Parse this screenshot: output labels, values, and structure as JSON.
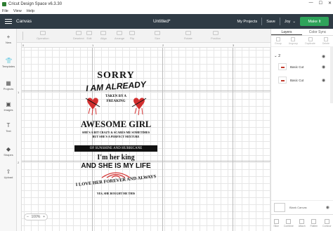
{
  "os": {
    "title": "Cricut Design Space  v6.3.30",
    "menu": [
      "File",
      "View",
      "Help"
    ],
    "win_controls": [
      "—",
      "☐",
      "✕"
    ]
  },
  "header": {
    "section": "Canvas",
    "doc_title": "Untitled*",
    "my_projects": "My Projects",
    "save": "Save",
    "machine": "Joy",
    "make_it": "Make It"
  },
  "toolbar": {
    "items": [
      "Operation",
      "Deselect",
      "Edit",
      "Align",
      "Arrange",
      "Flip",
      "Size",
      "Rotate",
      "Position"
    ]
  },
  "sidebar": {
    "items": [
      {
        "label": "New",
        "icon": "+"
      },
      {
        "label": "Templates",
        "icon": "👕"
      },
      {
        "label": "Projects",
        "icon": "▦"
      },
      {
        "label": "Images",
        "icon": "▣"
      },
      {
        "label": "Text",
        "icon": "T"
      },
      {
        "label": "Shapes",
        "icon": "◆"
      },
      {
        "label": "Upload",
        "icon": "⇧"
      }
    ]
  },
  "rulers": {
    "top": [
      "0",
      "1",
      "2",
      "3"
    ],
    "left": [
      "1",
      "2"
    ]
  },
  "design": {
    "line1": "SORRY",
    "line2": "I AM ALREADY",
    "line3": "TAKEN BY A",
    "line4": "FREAKING",
    "line5": "AWESOME GIRL",
    "line6": "SHE'S A BIT CRAZY & SCARES ME SOMETIMES",
    "line7": "BUT SHE'S A PERFECT MIXTURE",
    "banner": "OF SUNSHINE AND HURRICANE",
    "line8": "I'm her king",
    "line9": "AND SHE IS MY LIFE",
    "line10": "I LOVE HER FOREVER AND ALWAYS",
    "line11": "YES, SHE BOUGHT ME THIS"
  },
  "zoom": {
    "minus": "–",
    "value": "100%",
    "plus": "+"
  },
  "panel": {
    "tabs": [
      "Layers",
      "Color Sync"
    ],
    "tools": [
      "Group",
      "Ungroup",
      "Duplicate",
      "Delete"
    ],
    "group_count": "2",
    "layers": [
      "Basic Cut",
      "Basic Cut"
    ],
    "blank_canvas": "Blank Canvas",
    "bottom": [
      "Slice",
      "Combine",
      "Attach",
      "Flatten",
      "Contour"
    ]
  }
}
